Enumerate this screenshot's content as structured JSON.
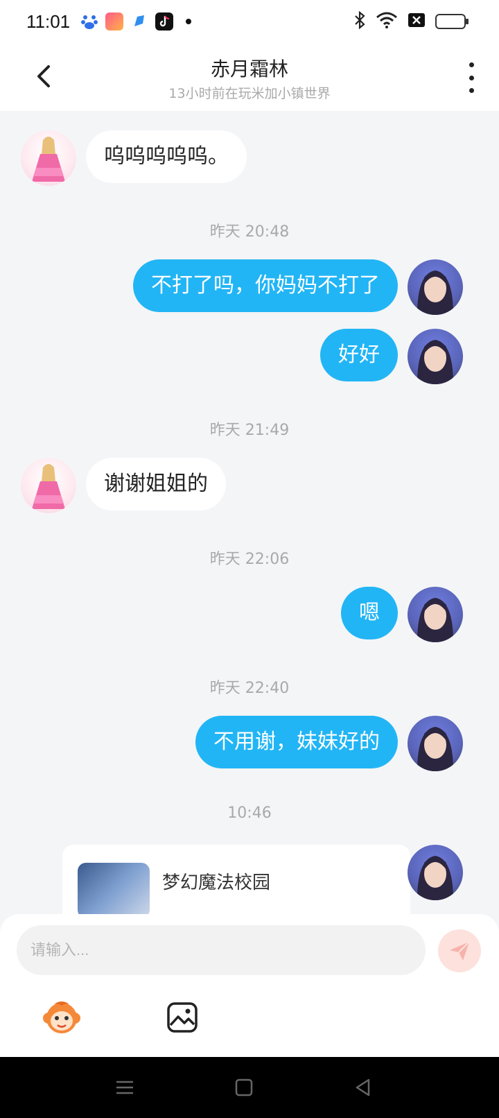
{
  "status": {
    "time": "11:01",
    "apps": [
      "baidu-icon",
      "game-icon",
      "feather-icon",
      "tiktok-icon"
    ],
    "right_icons": [
      "bluetooth-icon",
      "wifi-icon",
      "sim-icon",
      "battery-icon"
    ],
    "battery_level": 0.9
  },
  "header": {
    "title": "赤月霜林",
    "subtitle": "13小时前在玩米加小镇世界",
    "back_icon": "chevron-left-icon",
    "more_icon": "more-vertical-icon"
  },
  "messages": [
    {
      "side": "left",
      "text": "呜呜呜呜呜。"
    },
    {
      "timestamp": "昨天 20:48"
    },
    {
      "side": "right",
      "text": "不打了吗，你妈妈不打了"
    },
    {
      "side": "right",
      "text": "好好"
    },
    {
      "timestamp": "昨天 21:49"
    },
    {
      "side": "left",
      "text": "谢谢姐姐的"
    },
    {
      "timestamp": "昨天 22:06"
    },
    {
      "side": "right",
      "text": "嗯"
    },
    {
      "timestamp": "昨天 22:40"
    },
    {
      "side": "right",
      "text": "不用谢，妹妹好的"
    },
    {
      "timestamp": "10:46"
    },
    {
      "side": "right",
      "card_title": "梦幻魔法校园"
    }
  ],
  "input": {
    "placeholder": "请输入...",
    "value": ""
  },
  "toolbar": {
    "emoji_icon": "monkey-face-icon",
    "image_icon": "image-icon",
    "send_icon": "send-icon"
  },
  "colors": {
    "accent": "#22b5f5",
    "background": "#f4f5f7",
    "timestamp": "#a9a9a9"
  }
}
